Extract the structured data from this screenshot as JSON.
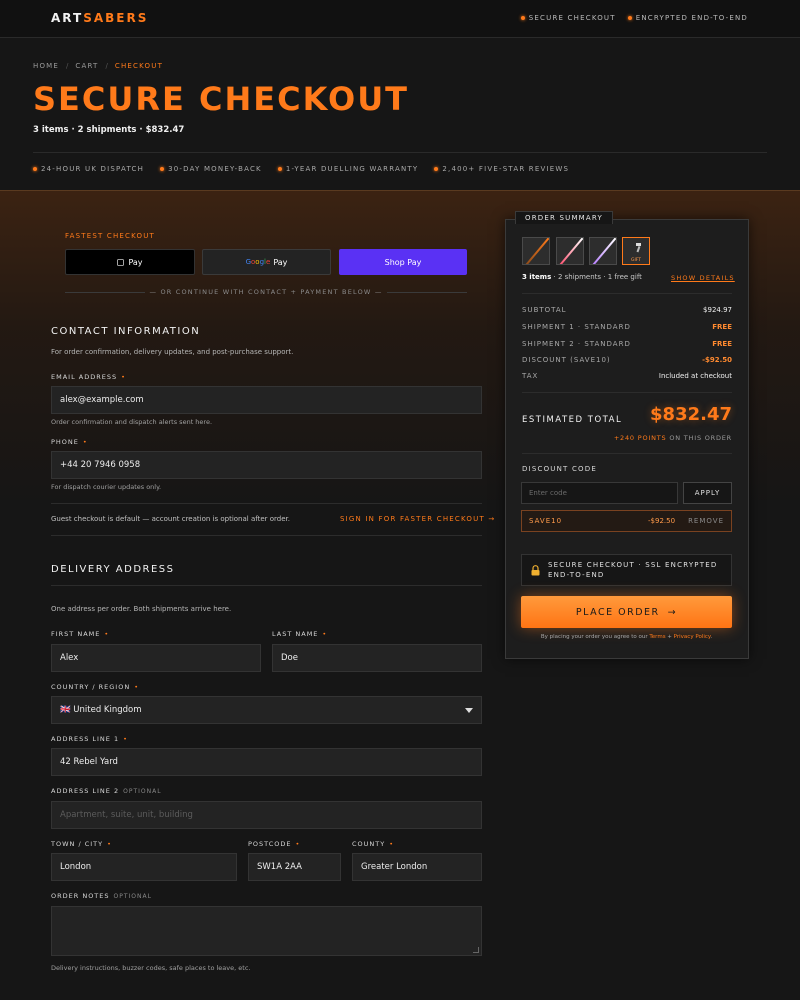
{
  "topbar": {
    "logo_part1": "ART",
    "logo_part2": "SABERS",
    "badges": [
      "SECURE CHECKOUT",
      "ENCRYPTED END-TO-END"
    ]
  },
  "header": {
    "breadcrumb": [
      "HOME",
      "CART",
      "CHECKOUT"
    ],
    "title": "SECURE CHECKOUT",
    "subtitle": "3 items · 2 shipments · $832.47",
    "trust": [
      "24-HOUR UK DISPATCH",
      "30-DAY MONEY-BACK",
      "1-YEAR DUELLING WARRANTY",
      "2,400+ FIVE-STAR REVIEWS"
    ]
  },
  "express": {
    "label": "FASTEST CHECKOUT",
    "apple_text": "Pay",
    "google_word": [
      "G",
      "o",
      "o",
      "g",
      "l",
      "e"
    ],
    "google_pay": "Pay",
    "shop": "Shop Pay",
    "divider": "— OR CONTINUE WITH CONTACT + PAYMENT BELOW —"
  },
  "contact": {
    "title": "CONTACT INFORMATION",
    "desc": "For order confirmation, delivery updates, and post-purchase support.",
    "email_label": "EMAIL ADDRESS",
    "email_value": "alex@example.com",
    "email_hint": "Order confirmation and dispatch alerts sent here.",
    "phone_label": "PHONE",
    "phone_value": "+44 20 7946 0958",
    "phone_hint": "For dispatch courier updates only.",
    "guest_text": "Guest checkout is default — account creation is optional after order.",
    "signin": "SIGN IN FOR FASTER CHECKOUT →"
  },
  "delivery": {
    "title": "DELIVERY ADDRESS",
    "desc": "One address per order. Both shipments arrive here.",
    "first_name_label": "FIRST NAME",
    "first_name": "Alex",
    "last_name_label": "LAST NAME",
    "last_name": "Doe",
    "country_label": "COUNTRY / REGION",
    "country": "🇬🇧  United Kingdom",
    "address1_label": "ADDRESS LINE 1",
    "address1": "42 Rebel Yard",
    "address2_label": "ADDRESS LINE 2",
    "address2_placeholder": "Apartment, suite, unit, building",
    "town_label": "TOWN / CITY",
    "town": "London",
    "postcode_label": "POSTCODE",
    "postcode": "SW1A 2AA",
    "county_label": "COUNTY",
    "county": "Greater London",
    "notes_label": "ORDER NOTES",
    "notes_hint": "Delivery instructions, buzzer codes, safe places to leave, etc.",
    "optional": "OPTIONAL",
    "required_mark": "•"
  },
  "summary": {
    "tab": "ORDER SUMMARY",
    "gift_tag": "GIFT",
    "items_bold": "3 items",
    "items_rest": " · 2 shipments · 1 free gift",
    "show_details": "SHOW DETAILS",
    "rows": [
      {
        "k": "SUBTOTAL",
        "v": "$924.97",
        "orange": false
      },
      {
        "k": "SHIPMENT 1 · STANDARD",
        "v": "FREE",
        "orange": true
      },
      {
        "k": "SHIPMENT 2 · STANDARD",
        "v": "FREE",
        "orange": true
      },
      {
        "k": "DISCOUNT (SAVE10)",
        "v": "-$92.50",
        "orange": true
      },
      {
        "k": "TAX",
        "v": "Included at checkout",
        "orange": false
      }
    ],
    "estimated_label": "ESTIMATED TOTAL",
    "estimated_value": "$832.47",
    "points_bold": "+240 POINTS",
    "points_rest": " ON THIS ORDER",
    "discount_label": "DISCOUNT CODE",
    "discount_placeholder": "Enter code",
    "apply": "APPLY",
    "applied_code": "SAVE10",
    "applied_amount": "-$92.50",
    "remove": "REMOVE",
    "secure_line1": "SECURE CHECKOUT · SSL ENCRYPTED",
    "secure_line2": "END-TO-END",
    "place_order": "PLACE ORDER",
    "place_arrow": "→",
    "terms_pre": "By placing your order you agree to our ",
    "terms_link1": "Terms",
    "terms_mid": " + ",
    "terms_link2": "Privacy Policy",
    "terms_post": "."
  },
  "colors": {
    "accent": "#ff7a1a",
    "background": "#161616",
    "shop_pay": "#5a31f4"
  }
}
